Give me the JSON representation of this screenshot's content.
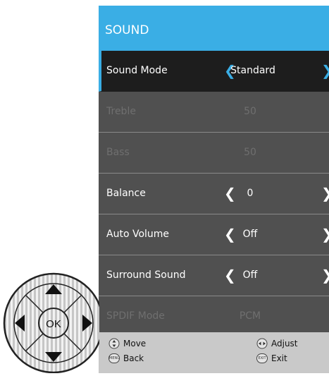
{
  "header": {
    "title": "SOUND"
  },
  "rows": [
    {
      "label": "Sound Mode",
      "value": "Standard",
      "state": "selected"
    },
    {
      "label": "Treble",
      "value": "50",
      "state": "disabled"
    },
    {
      "label": "Bass",
      "value": "50",
      "state": "disabled"
    },
    {
      "label": "Balance",
      "value": "0",
      "state": "normal"
    },
    {
      "label": "Auto Volume",
      "value": "Off",
      "state": "normal"
    },
    {
      "label": "Surround Sound",
      "value": "Off",
      "state": "normal"
    },
    {
      "label": "SPDIF Mode",
      "value": "PCM",
      "state": "disabled"
    }
  ],
  "footer": {
    "move": {
      "icon": "updown-icon",
      "label": "Move"
    },
    "adjust": {
      "icon": "leftright-icon",
      "label": "Adjust"
    },
    "back": {
      "icon": "menu-icon",
      "icon_text": "MENU",
      "label": "Back"
    },
    "exit": {
      "icon": "exit-icon",
      "icon_text": "EXIT",
      "label": "Exit"
    }
  },
  "dpad": {
    "ok_label": "OK"
  },
  "colors": {
    "accent": "#3aaee5",
    "panel": "#4a4a4a",
    "selected_row": "#1d1d1d",
    "footer": "#c9c9c9"
  }
}
